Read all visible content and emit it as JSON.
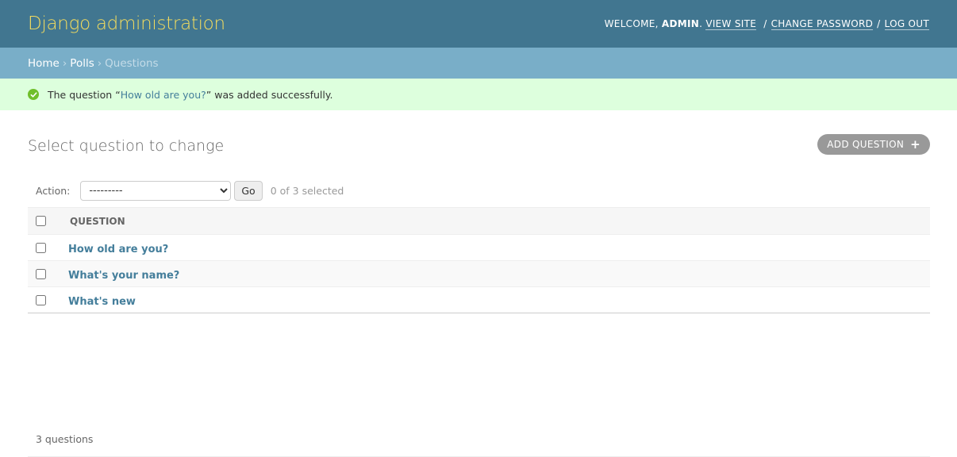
{
  "header": {
    "branding": "Django administration",
    "welcome_prefix": "Welcome,",
    "username": "admin",
    "view_site": "View site",
    "change_password": "Change password",
    "log_out": "Log out",
    "separator": "/"
  },
  "breadcrumbs": {
    "home": "Home",
    "app": "Polls",
    "current": "Questions",
    "chevron": "›"
  },
  "message": {
    "prefix": "The question “",
    "link": "How old are you?",
    "suffix": "” was added successfully."
  },
  "content": {
    "title": "Select question to change",
    "add_button": "Add question",
    "add_icon": "+"
  },
  "actions": {
    "label": "Action:",
    "select_value": "---------",
    "go": "Go",
    "counter": "0 of 3 selected"
  },
  "table": {
    "header": "Question",
    "rows": [
      "How old are you?",
      "What's your name?",
      "What's new"
    ]
  },
  "paginator": "3 questions",
  "colors": {
    "header_bg": "#417690",
    "branding": "#f5dd5d",
    "breadcrumbs_bg": "#79aec8",
    "success_bg": "#ddffdd",
    "link": "#447e9b"
  }
}
